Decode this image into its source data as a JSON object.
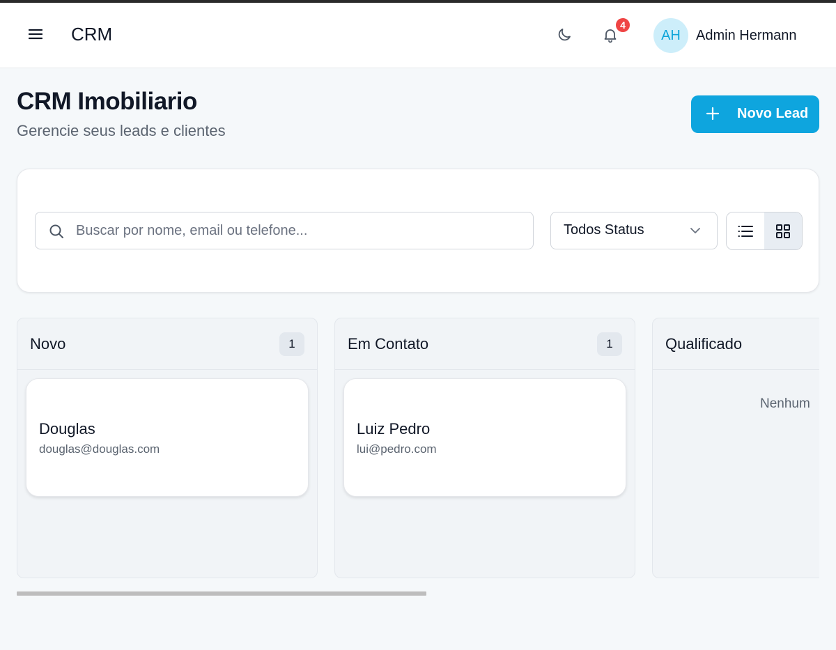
{
  "header": {
    "app_title": "CRM",
    "menu_icon": "hamburger-icon",
    "theme_icon": "moon-icon",
    "notifications": {
      "icon": "bell-icon",
      "count": "4"
    },
    "user": {
      "initials": "AH",
      "name": "Admin Hermann"
    }
  },
  "page": {
    "title": "CRM Imobiliario",
    "subtitle": "Gerencie seus leads e clientes",
    "new_lead_label": "Novo Lead"
  },
  "filters": {
    "search_placeholder": "Buscar por nome, email ou telefone...",
    "search_value": "",
    "status_selected": "Todos Status",
    "view_modes": [
      {
        "name": "list",
        "icon": "list-icon",
        "active": false
      },
      {
        "name": "grid",
        "icon": "grid-icon",
        "active": true
      }
    ]
  },
  "columns": [
    {
      "title": "Novo",
      "count": "1",
      "leads": [
        {
          "name": "Douglas",
          "email": "douglas@douglas.com"
        }
      ]
    },
    {
      "title": "Em Contato",
      "count": "1",
      "leads": [
        {
          "name": "Luiz Pedro",
          "email": "lui@pedro.com"
        }
      ]
    },
    {
      "title": "Qualificado",
      "count": "",
      "leads": [],
      "empty_text": "Nenhum"
    }
  ],
  "colors": {
    "accent": "#0ea5de",
    "badge": "#ef4444",
    "avatar_bg": "#cdeefa",
    "avatar_text": "#0ea5d9"
  }
}
